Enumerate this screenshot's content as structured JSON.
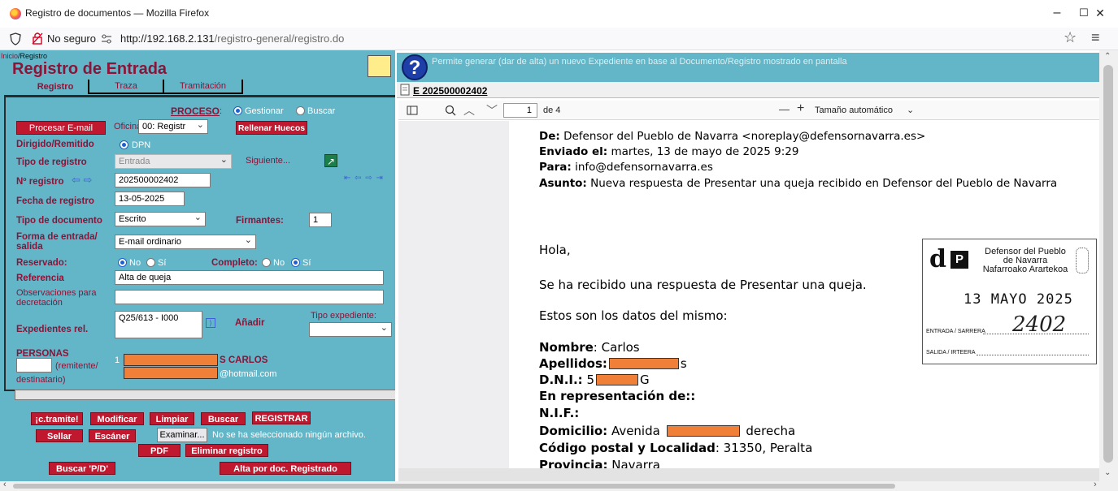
{
  "window": {
    "title": "Registro de documentos — Mozilla Firefox",
    "min_label": "–",
    "max_label": "☐",
    "close_label": "✕"
  },
  "nav": {
    "security": "No seguro",
    "url_host": "http://192.168.2.131",
    "url_path": "/registro-general/registro.do"
  },
  "breadcrumb": {
    "home": "Inicio",
    "current": "/Registro"
  },
  "page_title": "Registro de Entrada",
  "tabs": [
    "Registro",
    "Traza",
    "Tramitación"
  ],
  "form": {
    "proceso_label": "PROCESO",
    "proceso_options": [
      "Gestionar",
      "Buscar"
    ],
    "proceso_selected": "Gestionar",
    "procesar_email": "Procesar E-mail",
    "oficina_label": "Oficina:",
    "oficina_value": "00: Registr",
    "rellenar_huecos": "Rellenar Huecos",
    "dirigido_label": "Dirigido/Remitido",
    "dirigido_value": "DPN",
    "tipo_registro_label": "Tipo de registro",
    "tipo_registro_value": "Entrada",
    "siguiente_label": "Siguiente...",
    "n_registro_label": "Nº registro",
    "n_registro_value": "202500002402",
    "nav_arrows": "⇤ ⇦ ⇨ ⇥",
    "fecha_label": "Fecha de registro",
    "fecha_value": "13-05-2025",
    "tipo_doc_label": "Tipo de documento",
    "tipo_doc_value": "Escrito",
    "firmantes_label": "Firmantes:",
    "firmantes_value": "1",
    "forma_label_1": "Forma de entrada/",
    "forma_label_2": "salida",
    "forma_value": "E-mail ordinario",
    "reservado_label": "Reservado:",
    "no_label": "No",
    "si_label": "Sí",
    "completo_label": "Completo:",
    "referencia_label": "Referencia",
    "referencia_value": "Alta de queja",
    "observaciones_label_1": "Observaciones para",
    "observaciones_label_2": "decretación",
    "observaciones_value": "",
    "expedientes_label": "Expedientes rel.",
    "expedientes_value": "Q25/613 - I000",
    "anadir_label": "Añadir",
    "tipo_expediente_label": "Tipo expediente:",
    "tipo_expediente_value": "",
    "personas_label": "PERSONAS",
    "remitente_label": "(remitente/",
    "destinatario_label": "destinatario)",
    "persona_index": "1",
    "persona_name_suffix": "S CARLOS",
    "persona_email_suffix": "@hotmail.com"
  },
  "actions": {
    "c_tramite": "¡c.tramite!",
    "modificar": "Modificar",
    "limpiar": "Limpiar",
    "buscar": "Buscar",
    "registrar": "REGISTRAR",
    "sellar": "Sellar",
    "escaner": "Escáner",
    "examinar": "Examinar...",
    "no_file": "No se ha seleccionado ningún archivo.",
    "pdf": "PDF",
    "eliminar": "Eliminar registro",
    "buscar_pd": "Buscar 'P/D'",
    "alta_doc": "Alta por doc. Registrado"
  },
  "banner": {
    "help_text": "Permite generar (dar de alta) un nuevo Expediente en base al Documento/Registro mostrado en pantalla",
    "doc_id": "E 202500002402"
  },
  "pdf_toolbar": {
    "page_current": "1",
    "page_total": "de 4",
    "zoom_minus": "—",
    "zoom_plus": "+",
    "zoom_value": "Tamaño automático"
  },
  "pdf": {
    "de_label": "De:",
    "de_value": "Defensor del Pueblo de Navarra <noreplay@defensornavarra.es>",
    "enviado_label": "Enviado el:",
    "enviado_value": "martes, 13 de mayo de 2025 9:29",
    "para_label": "Para:",
    "para_value": "info@defensornavarra.es",
    "asunto_label": "Asunto:",
    "asunto_value": "Nueva respuesta de Presentar una queja recibido en Defensor del Pueblo de Navarra",
    "hola": "Hola,",
    "line1": "Se ha recibido una respuesta de Presentar una queja.",
    "line2": "Estos son los datos del mismo:",
    "nombre_label": "Nombre",
    "nombre_value": ": Carlos",
    "apellidos_label": "Apellidos:",
    "apellidos_suffix": "s",
    "dni_label": "D.N.I.:",
    "dni_prefix": "5",
    "dni_suffix": "G",
    "representacion_label": "En representación de::",
    "nif_label": "N.I.F.:",
    "domicilio_label": "Domicilio:",
    "domicilio_prefix": "Avenida",
    "domicilio_suffix": "derecha",
    "cp_label": "Código postal y Localidad",
    "cp_value": ": 31350, Peralta",
    "provincia_label": "Provincia:",
    "provincia_value": "Navarra"
  },
  "stamp": {
    "org_line1": "Defensor del Pueblo",
    "org_line2": "de Navarra",
    "org_line3": "Nafarroako Arartekoa",
    "date": "13 MAYO 2025",
    "entrada_label": "ENTRADA / SARRERA",
    "entrada_number": "2402",
    "salida_label": "SALIDA / IRTEERA"
  },
  "colors": {
    "panel_bg": "#62b6c8",
    "label_color": "#8c1438",
    "button_red": "#c0182f",
    "redacted_orange": "#f08038"
  }
}
